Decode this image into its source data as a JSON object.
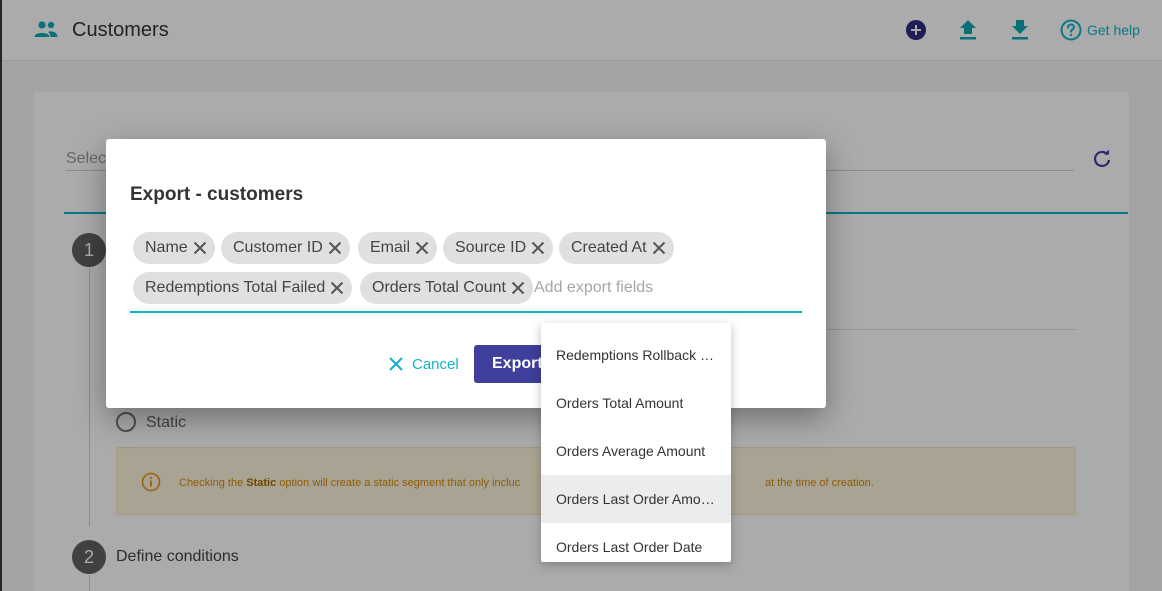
{
  "app": {
    "title": "Customers",
    "help_label": "Get help",
    "accent": "#0fb3c9",
    "icons": [
      "people-icon",
      "add-circle-icon",
      "upload-icon",
      "download-icon",
      "help-circle-icon"
    ]
  },
  "background": {
    "select_label": "Selec",
    "step1": "1",
    "step2": "2",
    "radio_label": "Static",
    "info_prefix": "Checking the ",
    "info_bold": "Static",
    "info_mid": " option will create a static segment that only incluc",
    "info_suffix": "at the time of creation.",
    "define_label": "Define conditions"
  },
  "dialog": {
    "title": "Export - customers",
    "chips": [
      "Name",
      "Customer ID",
      "Email",
      "Source ID",
      "Created At",
      "Redemptions Total Failed",
      "Orders Total Count"
    ],
    "input_placeholder": "Add export fields",
    "cancel_label": "Cancel",
    "export_label": "Export",
    "export_color": "#3f3f9c"
  },
  "dropdown": {
    "items": [
      "Redemptions Rollback …",
      "Orders Total Amount",
      "Orders Average Amount",
      "Orders Last Order Amo…",
      "Orders Last Order Date"
    ],
    "highlighted_index": 3
  }
}
